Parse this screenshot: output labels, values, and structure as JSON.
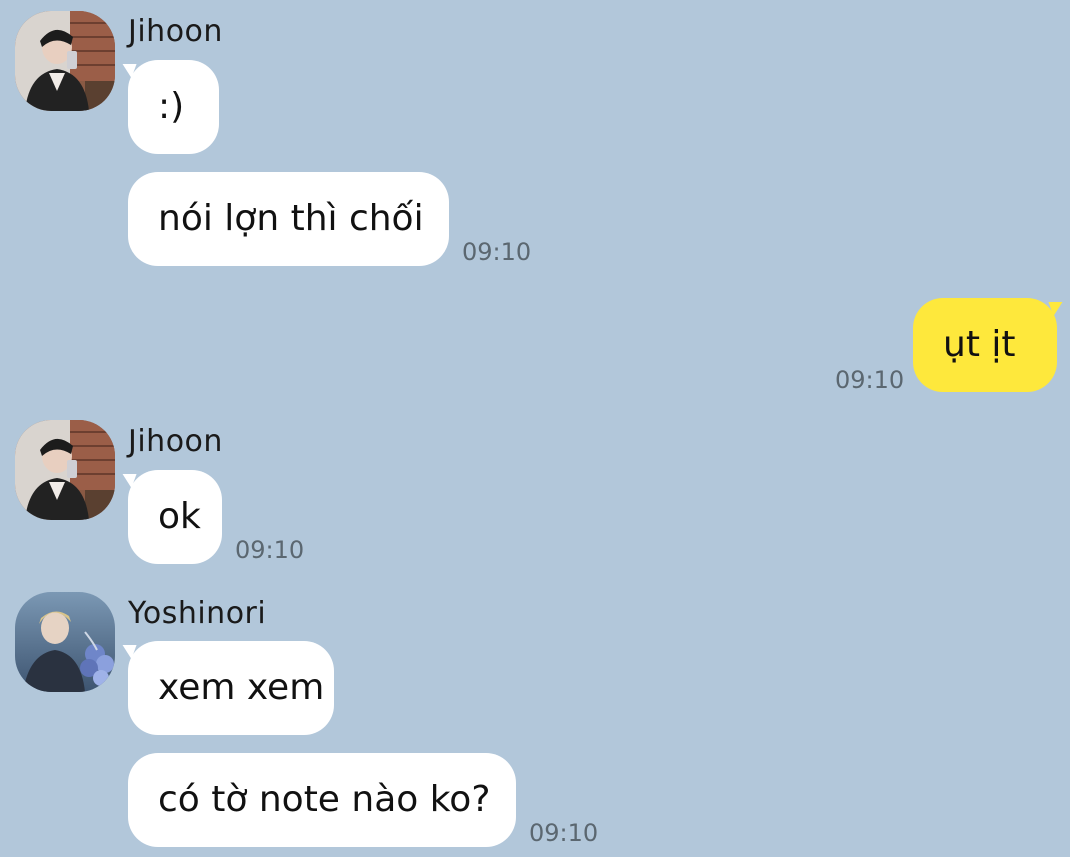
{
  "theme": {
    "background": "#b2c7da",
    "incoming_bubble": "#ffffff",
    "outgoing_bubble": "#fee83c",
    "timestamp_color": "#5b6770"
  },
  "messages": [
    {
      "sender": "Jihoon",
      "avatar": "jihoon-avatar",
      "text": ":)",
      "time": ""
    },
    {
      "sender": "Jihoon",
      "text": "nói lợn thì chối",
      "time": "09:10"
    },
    {
      "sender": "me",
      "text": "ụt ịt",
      "time": "09:10"
    },
    {
      "sender": "Jihoon",
      "avatar": "jihoon-avatar",
      "text": "ok",
      "time": "09:10"
    },
    {
      "sender": "Yoshinori",
      "avatar": "yoshinori-avatar",
      "text": "xem xem",
      "time": ""
    },
    {
      "sender": "Yoshinori",
      "text": "có tờ note nào ko?",
      "time": "09:10"
    }
  ]
}
